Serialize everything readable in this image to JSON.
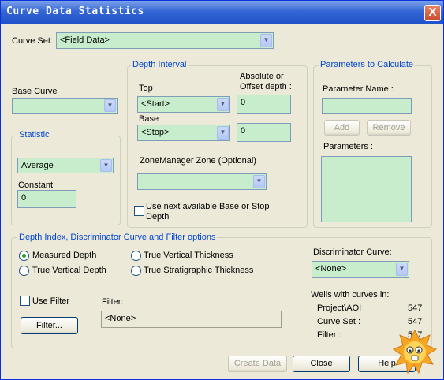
{
  "window": {
    "title": "Curve Data Statistics",
    "close": "X"
  },
  "curve_set": {
    "label": "Curve Set:",
    "value": "<Field Data>"
  },
  "base_curve": {
    "label": "Base Curve",
    "value": ""
  },
  "statistic": {
    "legend": "Statistic",
    "value": "Average",
    "constant_label": "Constant",
    "constant_value": "0"
  },
  "depth_interval": {
    "legend": "Depth Interval",
    "top_label": "Top",
    "top_value": "<Start>",
    "base_label": "Base",
    "base_value": "<Stop>",
    "abs_label_1": "Absolute or",
    "abs_label_2": "Offset depth :",
    "top_offset": "0",
    "base_offset": "0",
    "zone_label": "ZoneManager Zone (Optional)",
    "zone_value": "",
    "next_label_1": "Use next available Base or Stop",
    "next_label_2": "Depth"
  },
  "params": {
    "legend": "Parameters to Calculate",
    "name_label": "Parameter Name :",
    "name_value": "",
    "add": "Add",
    "remove": "Remove",
    "list_label": "Parameters :"
  },
  "depth_index": {
    "legend": "Depth Index, Discriminator Curve and Filter options",
    "measured": "Measured Depth",
    "tvd": "True Vertical Depth",
    "tvt": "True Vertical Thickness",
    "tst": "True Stratigraphic Thickness",
    "disc_label": "Discriminator Curve:",
    "disc_value": "<None>",
    "use_filter": "Use Filter",
    "filter_label": "Filter:",
    "filter_value": "<None>",
    "filter_btn": "Filter...",
    "wells_label": "Wells with curves in:",
    "project_label": "Project\\AOI",
    "project_count": "547",
    "curveset_label": "Curve Set :",
    "curveset_count": "547",
    "filter_count_label": "Filter :",
    "filter_count": "547"
  },
  "footer": {
    "create": "Create Data",
    "close": "Close",
    "help": "Help"
  },
  "colors": {
    "field_bg": "#c7edcc",
    "group_title": "#0046d5",
    "titlebar": "#2050c8"
  }
}
